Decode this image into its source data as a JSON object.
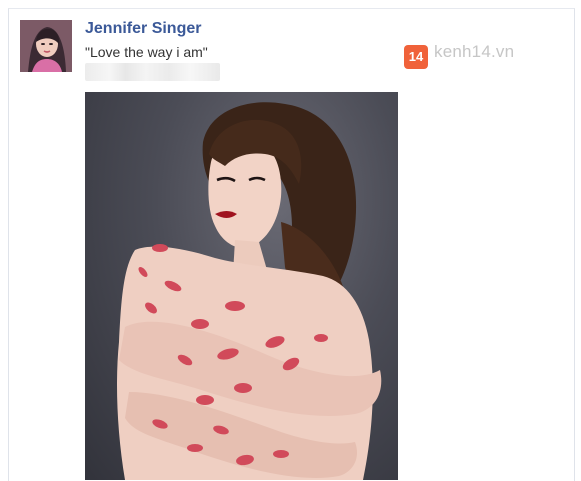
{
  "post": {
    "author_name": "Jennifer Singer",
    "caption": "\"Love the way i am\""
  },
  "watermark": {
    "badge_number": "14",
    "site": "kenh14.vn"
  },
  "icons": {
    "avatar": "profile-photo",
    "photo": "portrait-photo"
  }
}
